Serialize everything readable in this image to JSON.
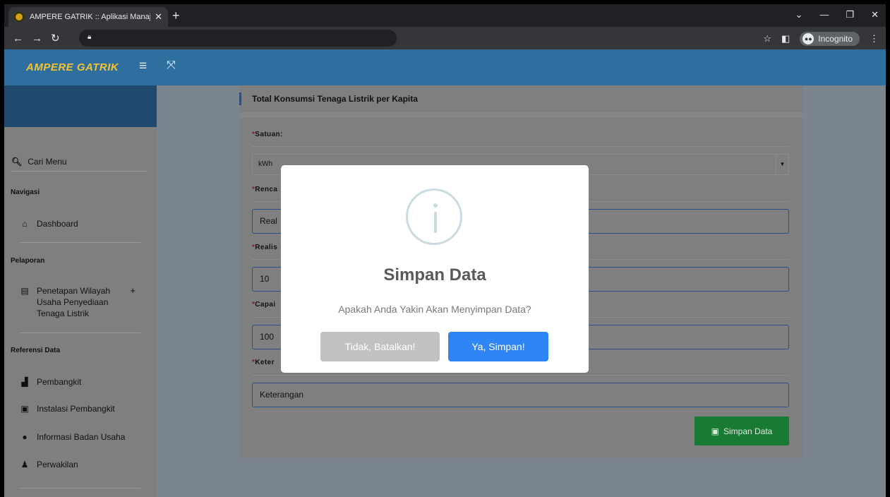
{
  "browser": {
    "tab_title": "AMPERE GATRIK :: Aplikasi Manaj",
    "tab_close": "✕",
    "new_tab": "+",
    "incognito_label": "Incognito"
  },
  "app": {
    "brand": "AMPERE GATRIK"
  },
  "sidebar": {
    "search_label": "Cari Menu",
    "sections": {
      "navigasi": "Navigasi",
      "pelaporan": "Pelaporan",
      "referensi": "Referensi Data"
    },
    "items": {
      "dashboard": "Dashboard",
      "penetapan": "Penetapan Wilayah Usaha Penyediaan Tenaga Listrik",
      "pembangkit": "Pembangkit",
      "instalasi": "Instalasi Pembangkit",
      "informasi": "Informasi Badan Usaha",
      "perwakilan": "Perwakilan"
    }
  },
  "form": {
    "title": "Total Konsumsi Tenaga Listrik per Kapita",
    "satuan_label": "Satuan:",
    "satuan_value": "kWh",
    "rencana_label": "Renca",
    "rencana_value": "Real",
    "realisasi_label": "Realis",
    "realisasi_value": "10",
    "capaian_label": "Capai",
    "capaian_value": "100",
    "keterangan_label": "Keter",
    "keterangan_placeholder": "Keterangan",
    "required_mark": "*",
    "save_label": "Simpan Data"
  },
  "modal": {
    "title": "Simpan Data",
    "text": "Apakah Anda Yakin Akan Menyimpan Data?",
    "cancel_label": "Tidak, Batalkan!",
    "confirm_label": "Ya, Simpan!"
  },
  "colors": {
    "header": "#2f6fa0",
    "brand": "#f4c430",
    "confirm": "#3085f6",
    "cancel": "#c1c1c1",
    "save": "#187a33"
  }
}
